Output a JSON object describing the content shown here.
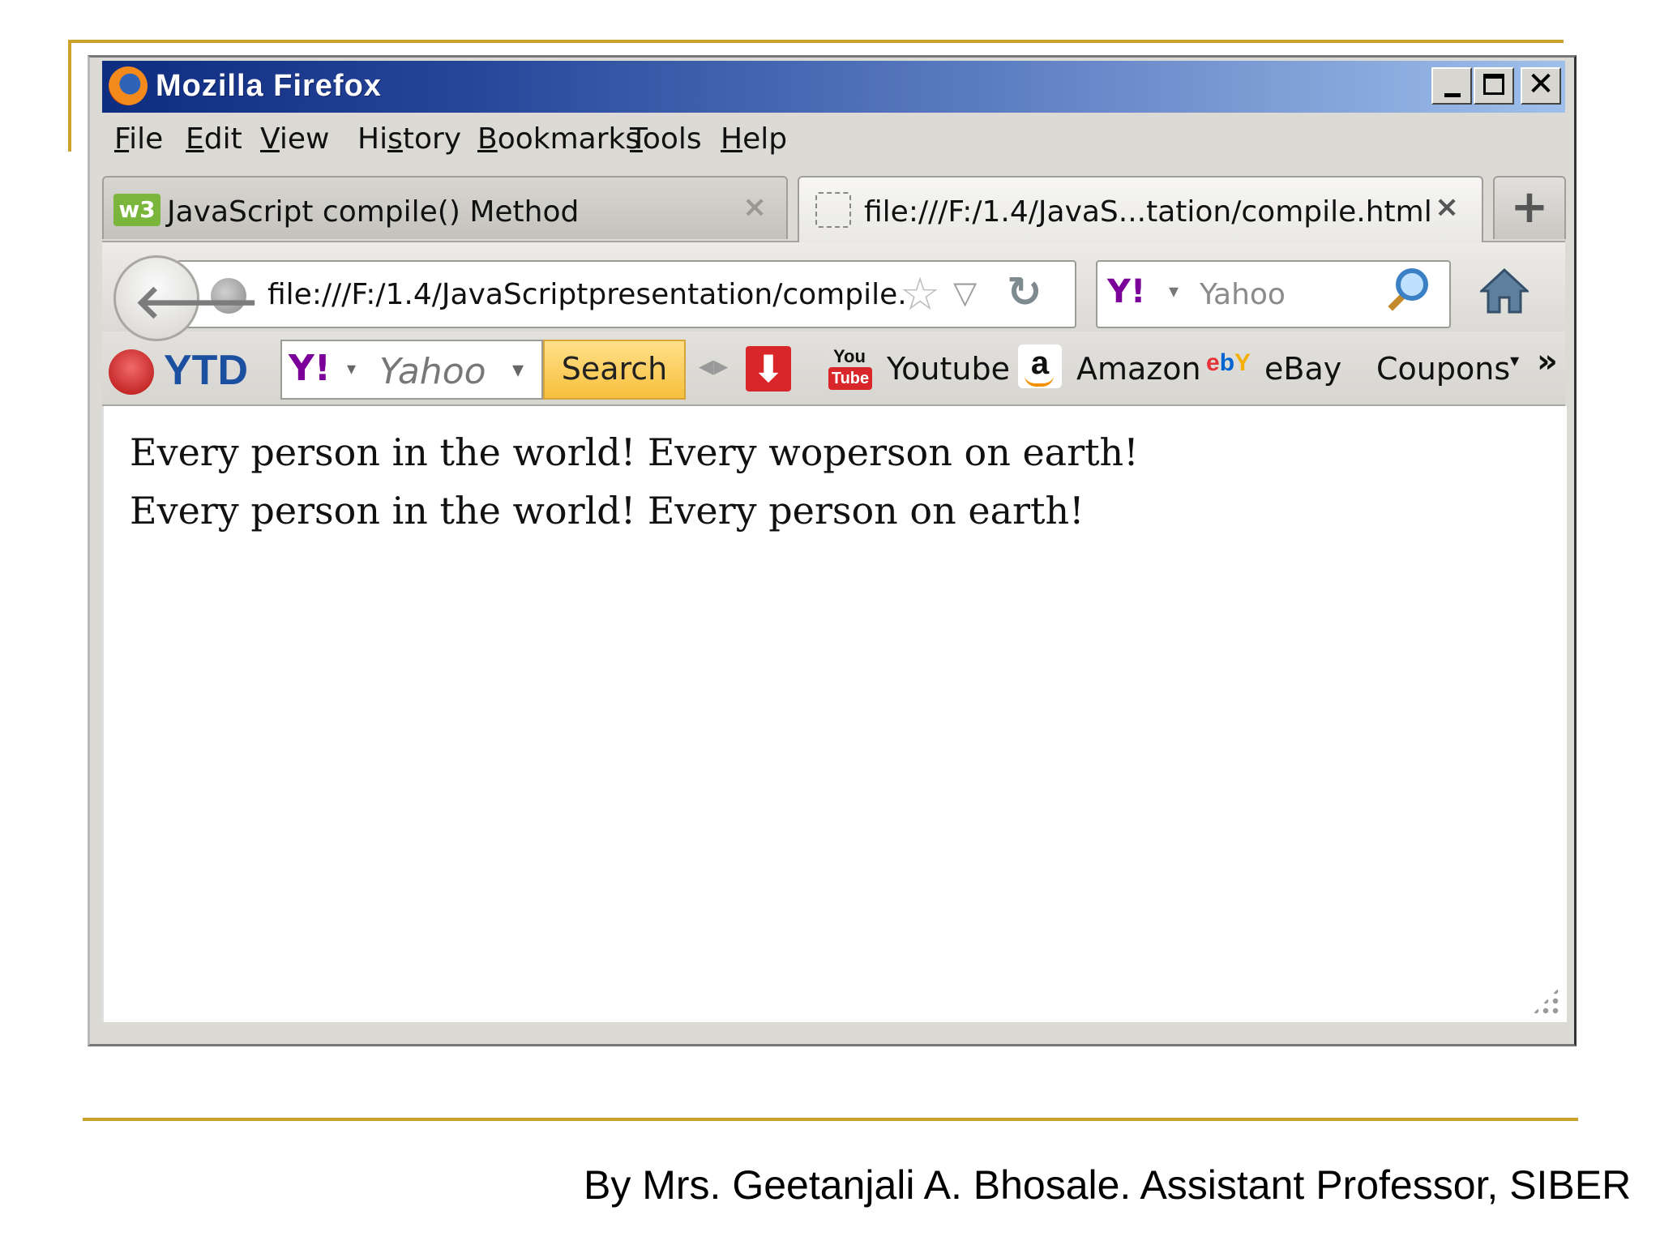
{
  "window": {
    "title": "Mozilla Firefox",
    "controls": {
      "minimize": "_",
      "maximize": "□",
      "close": "✕"
    }
  },
  "menu": [
    {
      "label": "File",
      "accesskey_index": 0
    },
    {
      "label": "Edit",
      "accesskey_index": 0
    },
    {
      "label": "View",
      "accesskey_index": 0
    },
    {
      "label": "History",
      "accesskey_index": 2
    },
    {
      "label": "Bookmarks",
      "accesskey_index": 0
    },
    {
      "label": "Tools",
      "accesskey_index": 0
    },
    {
      "label": "Help",
      "accesskey_index": 0
    }
  ],
  "tabs": [
    {
      "label": "JavaScript compile() Method",
      "active": false,
      "icon": "w3schools-icon",
      "icon_text": "w3"
    },
    {
      "label": "file:///F:/1.4/JavaS...tation/compile.html",
      "active": true,
      "icon": "blank-page-icon"
    }
  ],
  "tab_close_glyph": "×",
  "new_tab_glyph": "+",
  "navbar": {
    "back_glyph": "🡐",
    "url": "file:///F:/1.4/JavaScriptpresentation/compile.",
    "star_glyph": "☆",
    "dropmarker_glyph": "▽",
    "reload_glyph": "↻",
    "search_engine_logo": "Y!",
    "search_dropdown_glyph": "▾",
    "search_placeholder": "Yahoo"
  },
  "bookmarks_bar": {
    "ytd_label": "YTD",
    "yahoo_logo": "Y!",
    "yahoo_search_placeholder": "Yahoo",
    "yahoo_dropdown_glyph": "▾",
    "yahoo_search_button": "Search",
    "grip_glyph": "◂▸",
    "download_glyph": "⬇",
    "items": [
      {
        "label": "Youtube",
        "icon_top": "You",
        "icon_bottom": "Tube"
      },
      {
        "label": "Amazon",
        "icon_text": "a"
      },
      {
        "label": "eBay",
        "icon_text": "ebY"
      }
    ],
    "coupons_label": "Coupons",
    "coupons_dropdown_glyph": "▾",
    "more_glyph": "»"
  },
  "page_content": {
    "lines": [
      "Every person in the world! Every woperson on earth!",
      "Every person in the world! Every person on earth!"
    ]
  },
  "slide_footer": "By Mrs. Geetanjali A. Bhosale. Assistant Professor, SIBER",
  "colors": {
    "slide_accent": "#c9a227",
    "titlebar_start": "#0e2c80",
    "titlebar_end": "#9fc0ea",
    "yahoo_purple": "#7b0099",
    "search_button": "#f7c03d"
  }
}
